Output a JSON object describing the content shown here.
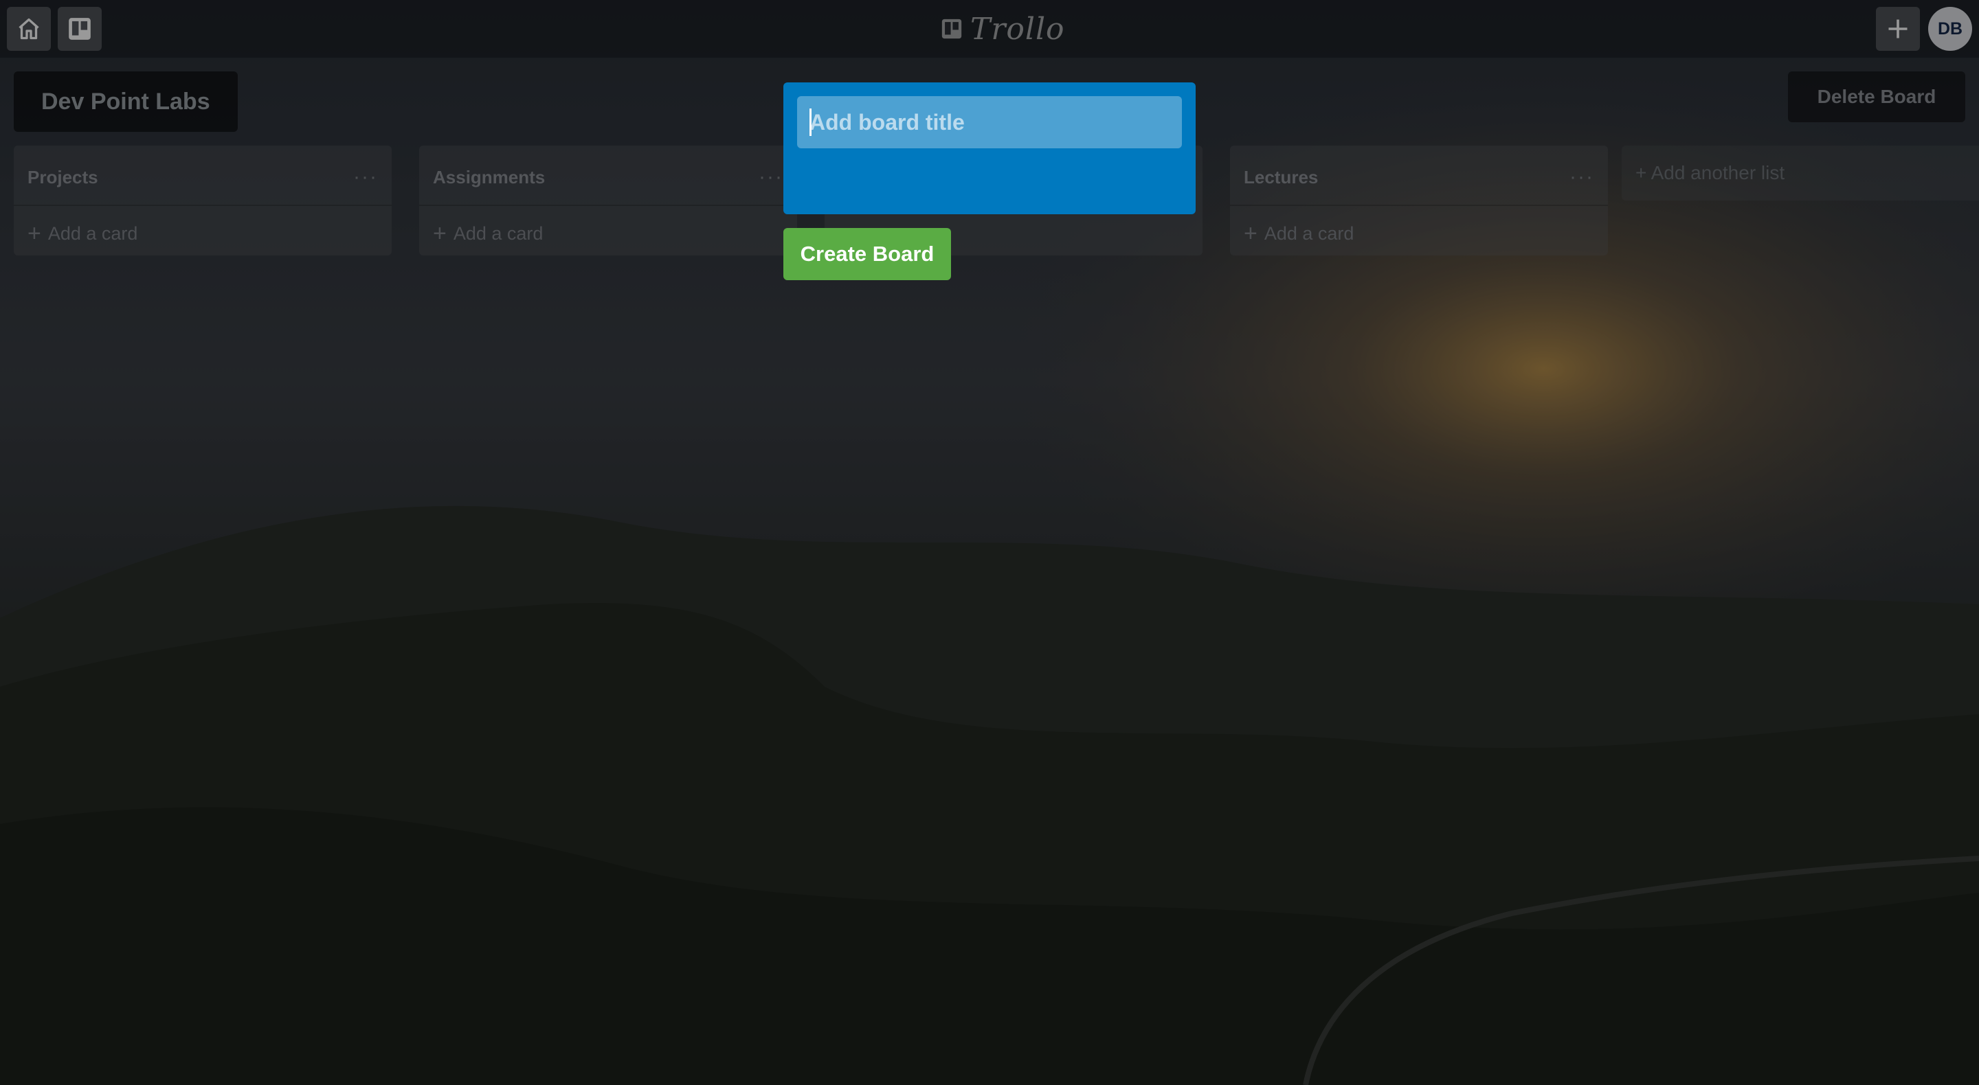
{
  "app": {
    "name": "Trollo",
    "user_initials": "DB"
  },
  "topbar": {
    "home_icon": "home-icon",
    "boards_icon": "boards-icon",
    "add_icon": "plus-icon"
  },
  "board": {
    "title": "Dev Point Labs",
    "delete_label": "Delete Board"
  },
  "lists": [
    {
      "title": "Projects",
      "add_card_label": "Add a card"
    },
    {
      "title": "Assignments",
      "add_card_label": "Add a card"
    },
    {
      "title": "Lectures",
      "add_card_label": "Add a card"
    }
  ],
  "add_list_label": "+ Add another list",
  "modal": {
    "title_placeholder": "Add board title",
    "title_value": "",
    "create_label": "Create Board"
  },
  "colors": {
    "modal": "#0079bf",
    "create_button": "#5aac44",
    "topbar": "#14181e"
  }
}
